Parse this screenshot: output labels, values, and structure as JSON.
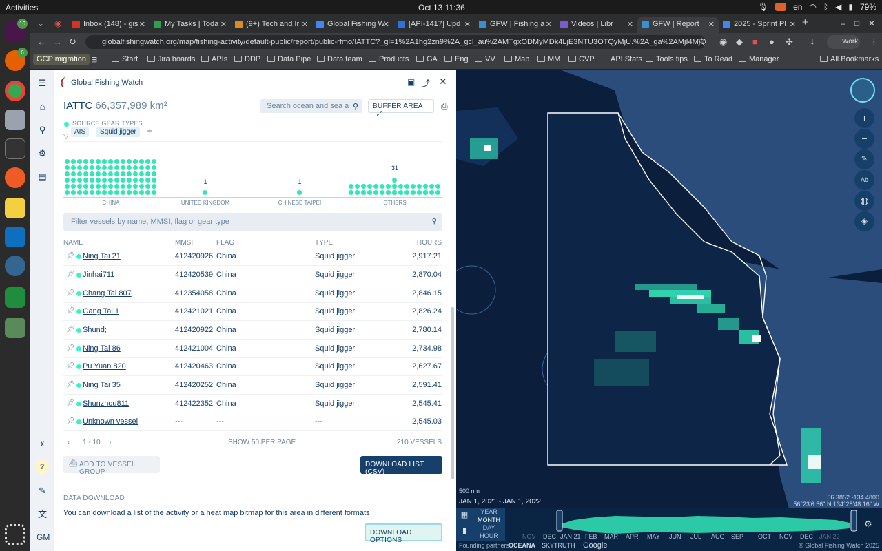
{
  "os": {
    "activities": "Activities",
    "clock": "Oct 13  11:36",
    "lang": "en",
    "battery": "79%"
  },
  "dock": {
    "badge1": "10",
    "badge2": "6"
  },
  "browser": {
    "tabs": [
      {
        "title": "Inbox (148) - gis",
        "fav_color": "#d93025"
      },
      {
        "title": "My Tasks | Toda",
        "fav_color": "#2e9e4f"
      },
      {
        "title": "(9+) Tech and Ir",
        "fav_color": "#e08a1e"
      },
      {
        "title": "Global Fishing W",
        "fav_color": "#4285f4"
      },
      {
        "title": "[API-1417] Upd",
        "fav_color": "#2f6fe0"
      },
      {
        "title": "GFW | Fishing a",
        "fav_color": "#3a8fd1"
      },
      {
        "title": "Videos | Libr",
        "fav_color": "#7a5ad1"
      },
      {
        "title": "GFW | Report",
        "fav_color": "#3a8fd1"
      },
      {
        "title": "2025 - Sprint Pl",
        "fav_color": "#4285f4"
      }
    ],
    "url": "globalfishingwatch.org/map/fishing-activity/default-public/report/public-rfmo/IATTC?_gl=1%2A1hg2zn9%2A_gcl_au%2AMTgxODMyMDk4LjE3NTU3OTQyMjU.%2A_ga%2AMjI4MjQyODM3LjE3NTU...",
    "profile": "Work",
    "bookmarks": [
      "GCP migration",
      "Start",
      "Jira boards",
      "APIs",
      "DDP",
      "Data Pipe",
      "Data team",
      "Products",
      "GA",
      "Eng",
      "VV",
      "Map",
      "MM",
      "CVP",
      "API Stats",
      "Tools tips",
      "To Read",
      "Manager"
    ],
    "all_bookmarks": "All Bookmarks"
  },
  "panel": {
    "app_name": "Global Fishing Watch",
    "area_name": "IATTC",
    "area_size": "66,357,989 km²",
    "search_placeholder": "Search ocean and sea a",
    "buffer_label": "BUFFER AREA",
    "filter_label": "SOURCE GEAR TYPES",
    "chips": [
      "AIS",
      "Squid jigger"
    ],
    "vessel_filter_placeholder": "Filter vessels by name, MMSI, flag or gear type",
    "columns": [
      "NAME",
      "MMSI",
      "FLAG",
      "TYPE",
      "HOURS"
    ],
    "vessels": [
      {
        "name": "Ning Tai 21",
        "mmsi": "412420926",
        "flag": "China",
        "type": "Squid jigger",
        "hours": "2,917.21"
      },
      {
        "name": "Jinhai711",
        "mmsi": "412420539",
        "flag": "China",
        "type": "Squid jigger",
        "hours": "2,870.04"
      },
      {
        "name": "Chang Tai 807",
        "mmsi": "412354058",
        "flag": "China",
        "type": "Squid jigger",
        "hours": "2,846.15"
      },
      {
        "name": "Gang Tai 1",
        "mmsi": "412421021",
        "flag": "China",
        "type": "Squid jigger",
        "hours": "2,826.24"
      },
      {
        "name": "Shund;",
        "mmsi": "412420922",
        "flag": "China",
        "type": "Squid jigger",
        "hours": "2,780.14"
      },
      {
        "name": "Ning Tai 86",
        "mmsi": "412421004",
        "flag": "China",
        "type": "Squid jigger",
        "hours": "2,734.98"
      },
      {
        "name": "Pu Yuan 820",
        "mmsi": "412420463",
        "flag": "China",
        "type": "Squid jigger",
        "hours": "2,627.67"
      },
      {
        "name": "Ning Tai 35",
        "mmsi": "412420252",
        "flag": "China",
        "type": "Squid jigger",
        "hours": "2,591.41"
      },
      {
        "name": "Shunzhou811",
        "mmsi": "412422352",
        "flag": "China",
        "type": "Squid jigger",
        "hours": "2,545.41"
      },
      {
        "name": "Unknown vessel",
        "mmsi": "---",
        "flag": "---",
        "type": "---",
        "hours": "2,545.03"
      }
    ],
    "pagination": {
      "range": "1 - 10",
      "per_page": "SHOW 50 PER PAGE",
      "total": "210 VESSELS"
    },
    "add_group_label": "ADD TO VESSEL GROUP",
    "download_csv_label": "DOWNLOAD LIST (CSV)",
    "data_download_title": "DATA DOWNLOAD",
    "data_download_text": "You can download a list of the activity or a heat map bitmap for this area in different formats",
    "download_options_label": "DOWNLOAD OPTIONS"
  },
  "rail": {
    "help": "?",
    "user": "GM"
  },
  "map": {
    "scale": "500 nm",
    "date_range": "JAN 1, 2021 - JAN 1, 2022",
    "coord_decimal": "56.3852  -134.4800",
    "coord_dms": "56°23'6.56\" N 134°28'48.16\" W",
    "resolutions": [
      "YEAR",
      "MONTH",
      "DAY",
      "HOUR"
    ],
    "selected_resolution": "MONTH",
    "months": [
      "NOV",
      "DEC",
      "JAN 21",
      "FEB",
      "MAR",
      "APR",
      "MAY",
      "JUN",
      "JUL",
      "AUG",
      "SEP",
      "OCT",
      "NOV",
      "DEC",
      "JAN 22"
    ],
    "footer_partners": "Founding partners",
    "partner_oceana": "OCEANA",
    "partner_skytruth": "SKYTRUTH",
    "partner_google": "Google",
    "copyright": "© Global Fishing Watch 2025",
    "map_ab_label": "Ab"
  },
  "chart_data": {
    "type": "bar",
    "title": "",
    "categories": [
      "CHINA",
      "UNITED KINGDOM",
      "CHINESE TAIPEI",
      "OTHERS"
    ],
    "values": [
      null,
      1,
      1,
      31
    ],
    "xlabel": "",
    "ylabel": ""
  }
}
